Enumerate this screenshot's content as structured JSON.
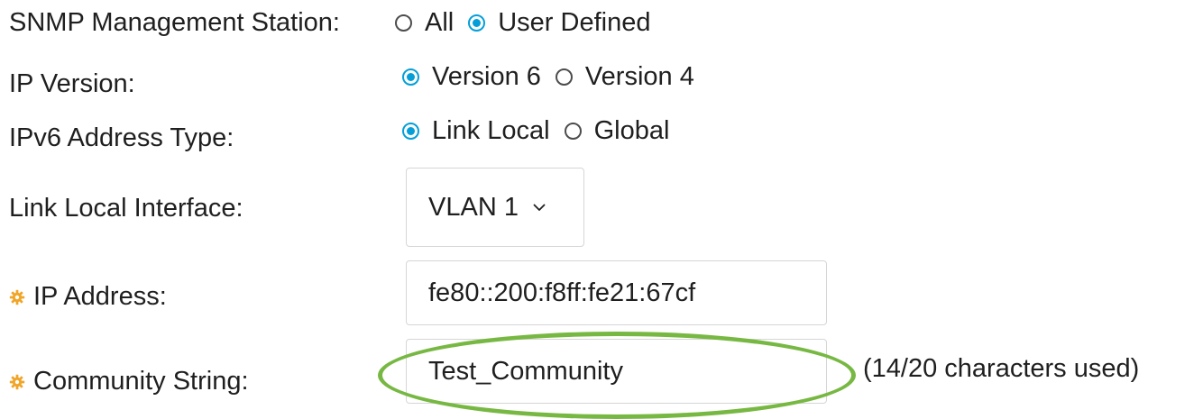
{
  "snmp_station": {
    "label": "SNMP Management Station:",
    "options": [
      {
        "label": "All",
        "checked": false
      },
      {
        "label": "User Defined",
        "checked": true
      }
    ]
  },
  "ip_version": {
    "label": "IP Version:",
    "options": [
      {
        "label": "Version 6",
        "checked": true
      },
      {
        "label": "Version 4",
        "checked": false
      }
    ]
  },
  "ipv6_address_type": {
    "label": "IPv6 Address Type:",
    "options": [
      {
        "label": "Link Local",
        "checked": true
      },
      {
        "label": "Global",
        "checked": false
      }
    ]
  },
  "link_local_interface": {
    "label": "Link Local Interface:",
    "selected": "VLAN 1"
  },
  "ip_address": {
    "label": "IP Address:",
    "value": "fe80::200:f8ff:fe21:67cf"
  },
  "community_string": {
    "label": "Community String:",
    "value": "Test_Community",
    "hint": "(14/20 characters used)"
  },
  "colors": {
    "accent": "#049fd9",
    "required_icon": "#f0a52a",
    "highlight": "#77b843"
  }
}
